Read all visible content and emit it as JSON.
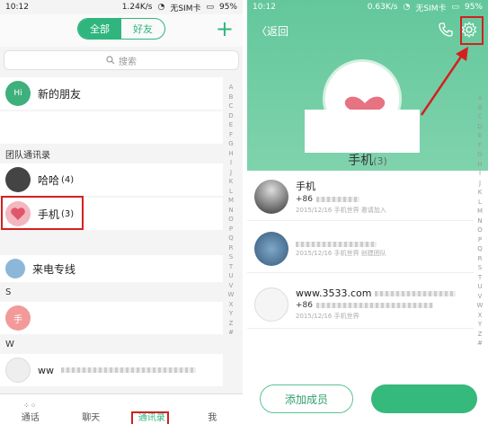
{
  "left": {
    "status": {
      "time": "10:12",
      "speed": "1.24K/s",
      "carrier": "无SIM卡",
      "battery": "95%"
    },
    "segment": {
      "all": "全部",
      "friends": "好友"
    },
    "add_icon": "plus-icon",
    "search_placeholder": "搜索",
    "new_friends": {
      "badge": "Hi",
      "label": "新的朋友"
    },
    "section_team": "团队通讯录",
    "groups": [
      {
        "name": "哈哈",
        "count": "(4)"
      },
      {
        "name": "手机",
        "count": "(3)"
      }
    ],
    "laidian": "来电专线",
    "section_s": "S",
    "s_avatar": "手",
    "section_w": "W",
    "w_contact": "ww",
    "alphabet": [
      "A",
      "B",
      "C",
      "D",
      "E",
      "F",
      "G",
      "H",
      "I",
      "J",
      "K",
      "L",
      "M",
      "N",
      "O",
      "P",
      "Q",
      "R",
      "S",
      "T",
      "U",
      "V",
      "W",
      "X",
      "Y",
      "Z",
      "#"
    ],
    "tabs": [
      "通话",
      "聊天",
      "通讯录",
      "我"
    ]
  },
  "right": {
    "status": {
      "time": "10:12",
      "speed": "0.63K/s",
      "carrier": "无SIM卡",
      "battery": "95%"
    },
    "back_label": "〈返回",
    "group_title": "手机",
    "group_count": "(3)",
    "members": [
      {
        "name": "手机",
        "phone_prefix": "+86",
        "date": "2015/12/16 手机世界 邀请加入"
      },
      {
        "name": "",
        "phone_prefix": "",
        "date": "2015/12/16 手机世界 创建团队"
      },
      {
        "name": "www.3533.com",
        "phone_prefix": "+86",
        "date": "2015/12/16 手机世界"
      }
    ],
    "alphabet": [
      "A",
      "B",
      "C",
      "D",
      "E",
      "F",
      "G",
      "H",
      "I",
      "J",
      "K",
      "L",
      "M",
      "N",
      "O",
      "P",
      "Q",
      "R",
      "S",
      "T",
      "U",
      "V",
      "W",
      "X",
      "Y",
      "Z",
      "#"
    ],
    "add_member_button": "添加成员",
    "colors": {
      "accent": "#2fb57d",
      "highlight": "#d42020"
    }
  }
}
